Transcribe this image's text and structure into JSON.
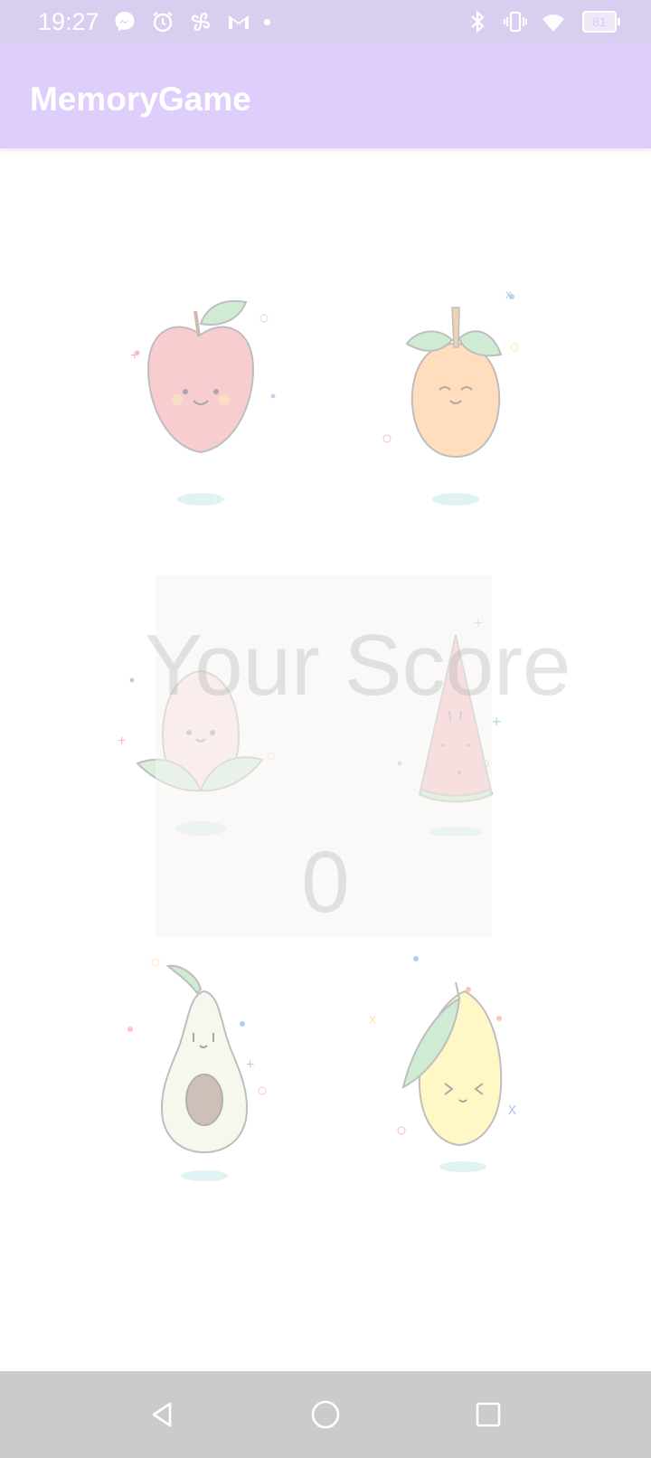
{
  "status_bar": {
    "time": "19:27",
    "battery_level": "81",
    "icons": [
      "messenger-icon",
      "alarm-icon",
      "pinwheel-icon",
      "gmail-icon",
      "bluetooth-icon",
      "vibrate-icon",
      "wifi-icon",
      "battery-icon"
    ]
  },
  "app_bar": {
    "title": "MemoryGame"
  },
  "cards": [
    {
      "icon": "apple-icon"
    },
    {
      "icon": "orange-icon"
    },
    {
      "icon": "peach-icon"
    },
    {
      "icon": "watermelon-icon"
    },
    {
      "icon": "avocado-icon"
    },
    {
      "icon": "lemon-icon"
    }
  ],
  "score": {
    "label": "Your Score",
    "value": "0"
  },
  "nav_bar": {
    "buttons": [
      "back-icon",
      "home-icon",
      "recents-icon"
    ]
  },
  "colors": {
    "status_bar": "#d9cef0",
    "app_bar": "#dfcdfb",
    "nav_bar": "#cbcbcb",
    "score_text": "#aaaaaa"
  }
}
